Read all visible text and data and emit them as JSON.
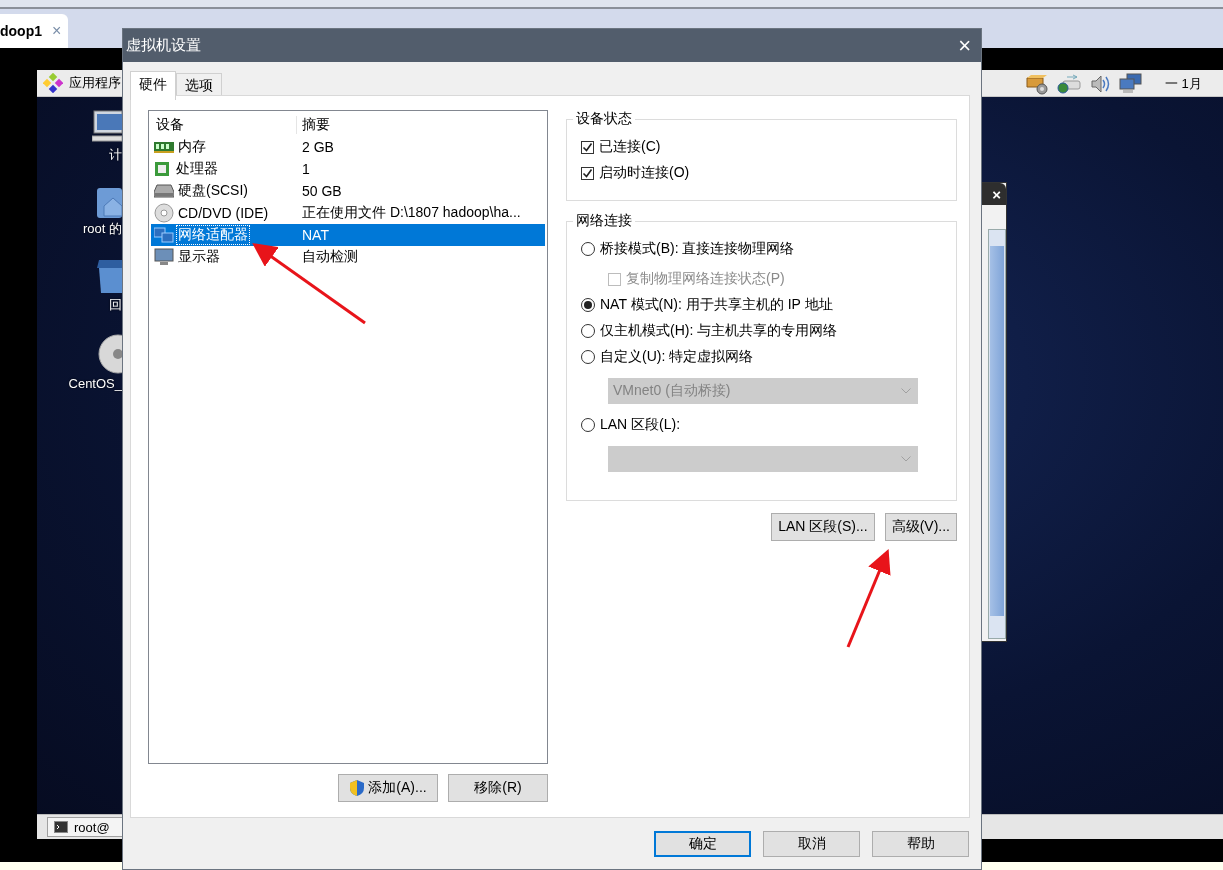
{
  "host_tab": {
    "label": "doop1",
    "close": "×"
  },
  "guest_panel": {
    "menu": "应用程序",
    "clock": "一 1月"
  },
  "desktop_icons": [
    {
      "kind": "computer",
      "label": "计"
    },
    {
      "kind": "home",
      "label": "root 的"
    },
    {
      "kind": "trash",
      "label": "回"
    },
    {
      "kind": "disc",
      "label": "CentOS_"
    }
  ],
  "taskbar": {
    "item": "root@"
  },
  "back_window": {
    "close": "×"
  },
  "dialog": {
    "title": "虚拟机设置",
    "close": "×",
    "tabs": [
      {
        "label": "硬件",
        "selected": true
      },
      {
        "label": "选项",
        "selected": false
      }
    ],
    "device_table": {
      "columns": [
        "设备",
        "摘要"
      ],
      "rows": [
        {
          "kind": "memory",
          "device": "内存",
          "summary": "2 GB",
          "selected": false
        },
        {
          "kind": "cpu",
          "device": "处理器",
          "summary": "1",
          "selected": false
        },
        {
          "kind": "disk",
          "device": "硬盘(SCSI)",
          "summary": "50 GB",
          "selected": false
        },
        {
          "kind": "cd",
          "device": "CD/DVD (IDE)",
          "summary": "正在使用文件 D:\\1807 hadoop\\ha...",
          "selected": false
        },
        {
          "kind": "network",
          "device": "网络适配器",
          "summary": "NAT",
          "selected": true
        },
        {
          "kind": "display",
          "device": "显示器",
          "summary": "自动检测",
          "selected": false
        }
      ]
    },
    "list_buttons": [
      {
        "label": "添加(A)...",
        "shield": true
      },
      {
        "label": "移除(R)",
        "shield": false
      }
    ],
    "device_status": {
      "title": "设备状态",
      "options": [
        {
          "label": "已连接(C)",
          "checked": true
        },
        {
          "label": "启动时连接(O)",
          "checked": true
        }
      ]
    },
    "network": {
      "title": "网络连接",
      "options": [
        {
          "kind": "radio",
          "label": "桥接模式(B): 直接连接物理网络",
          "selected": false
        },
        {
          "kind": "checkbox",
          "label": "复制物理网络连接状态(P)",
          "checked": false,
          "disabled": true
        },
        {
          "kind": "radio",
          "label": "NAT 模式(N): 用于共享主机的 IP 地址",
          "selected": true
        },
        {
          "kind": "radio",
          "label": "仅主机模式(H): 与主机共享的专用网络",
          "selected": false
        },
        {
          "kind": "radio",
          "label": "自定义(U): 特定虚拟网络",
          "selected": false
        },
        {
          "kind": "dropdown",
          "value": "VMnet0 (自动桥接)",
          "disabled": true
        },
        {
          "kind": "radio",
          "label": "LAN 区段(L):",
          "selected": false
        },
        {
          "kind": "dropdown",
          "disabled": true
        }
      ]
    },
    "network_buttons": [
      "LAN 区段(S)...",
      "高级(V)..."
    ],
    "footer_buttons": [
      {
        "label": "确定",
        "default": true
      },
      {
        "label": "取消",
        "default": false
      },
      {
        "label": "帮助",
        "default": false
      }
    ]
  }
}
